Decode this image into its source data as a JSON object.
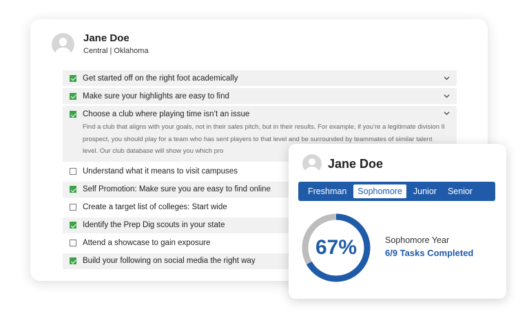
{
  "profile": {
    "name": "Jane Doe",
    "subtitle": "Central  |  Oklahoma"
  },
  "checklist": {
    "items": [
      {
        "label": "Get started off on the right foot academically",
        "checked": true
      },
      {
        "label": "Make sure your highlights are easy to find",
        "checked": true
      },
      {
        "label": "Choose a club where playing time isn’t an issue",
        "checked": true,
        "detail": "Find a club that aligns with your goals, not in their sales pitch, but in their results. For example, if you’re a legitimate division II prospect, you should play for a team who has sent players to that level and be surrounded by teammates of similar talent level. Our club database will show you which pro"
      },
      {
        "label": "Understand what it means to visit campuses",
        "checked": false
      },
      {
        "label": "Self Promotion: Make sure you are easy to find online",
        "checked": true
      },
      {
        "label": "Create a target list of colleges: Start wide",
        "checked": false
      },
      {
        "label": "Identify the Prep Dig scouts in your state",
        "checked": true
      },
      {
        "label": "Attend a showcase to gain exposure",
        "checked": false
      },
      {
        "label": "Build your following on social media the right way",
        "checked": true
      }
    ]
  },
  "popup": {
    "name": "Jane Doe",
    "years": [
      "Freshman",
      "Sophomore",
      "Junior",
      "Senior"
    ],
    "active_year": "Sophomore",
    "percent_label": "67%",
    "progress_fraction": 0.6667,
    "year_title": "Sophomore Year",
    "tasks_label": "6/9 Tasks Completed"
  },
  "colors": {
    "primary": "#1f5ba8",
    "check": "#3ca34a",
    "ring_track": "#bdbdbd"
  },
  "icons": {
    "avatar": "user-avatar-icon",
    "check": "checkmark-icon",
    "chevron": "chevron-down-icon"
  }
}
